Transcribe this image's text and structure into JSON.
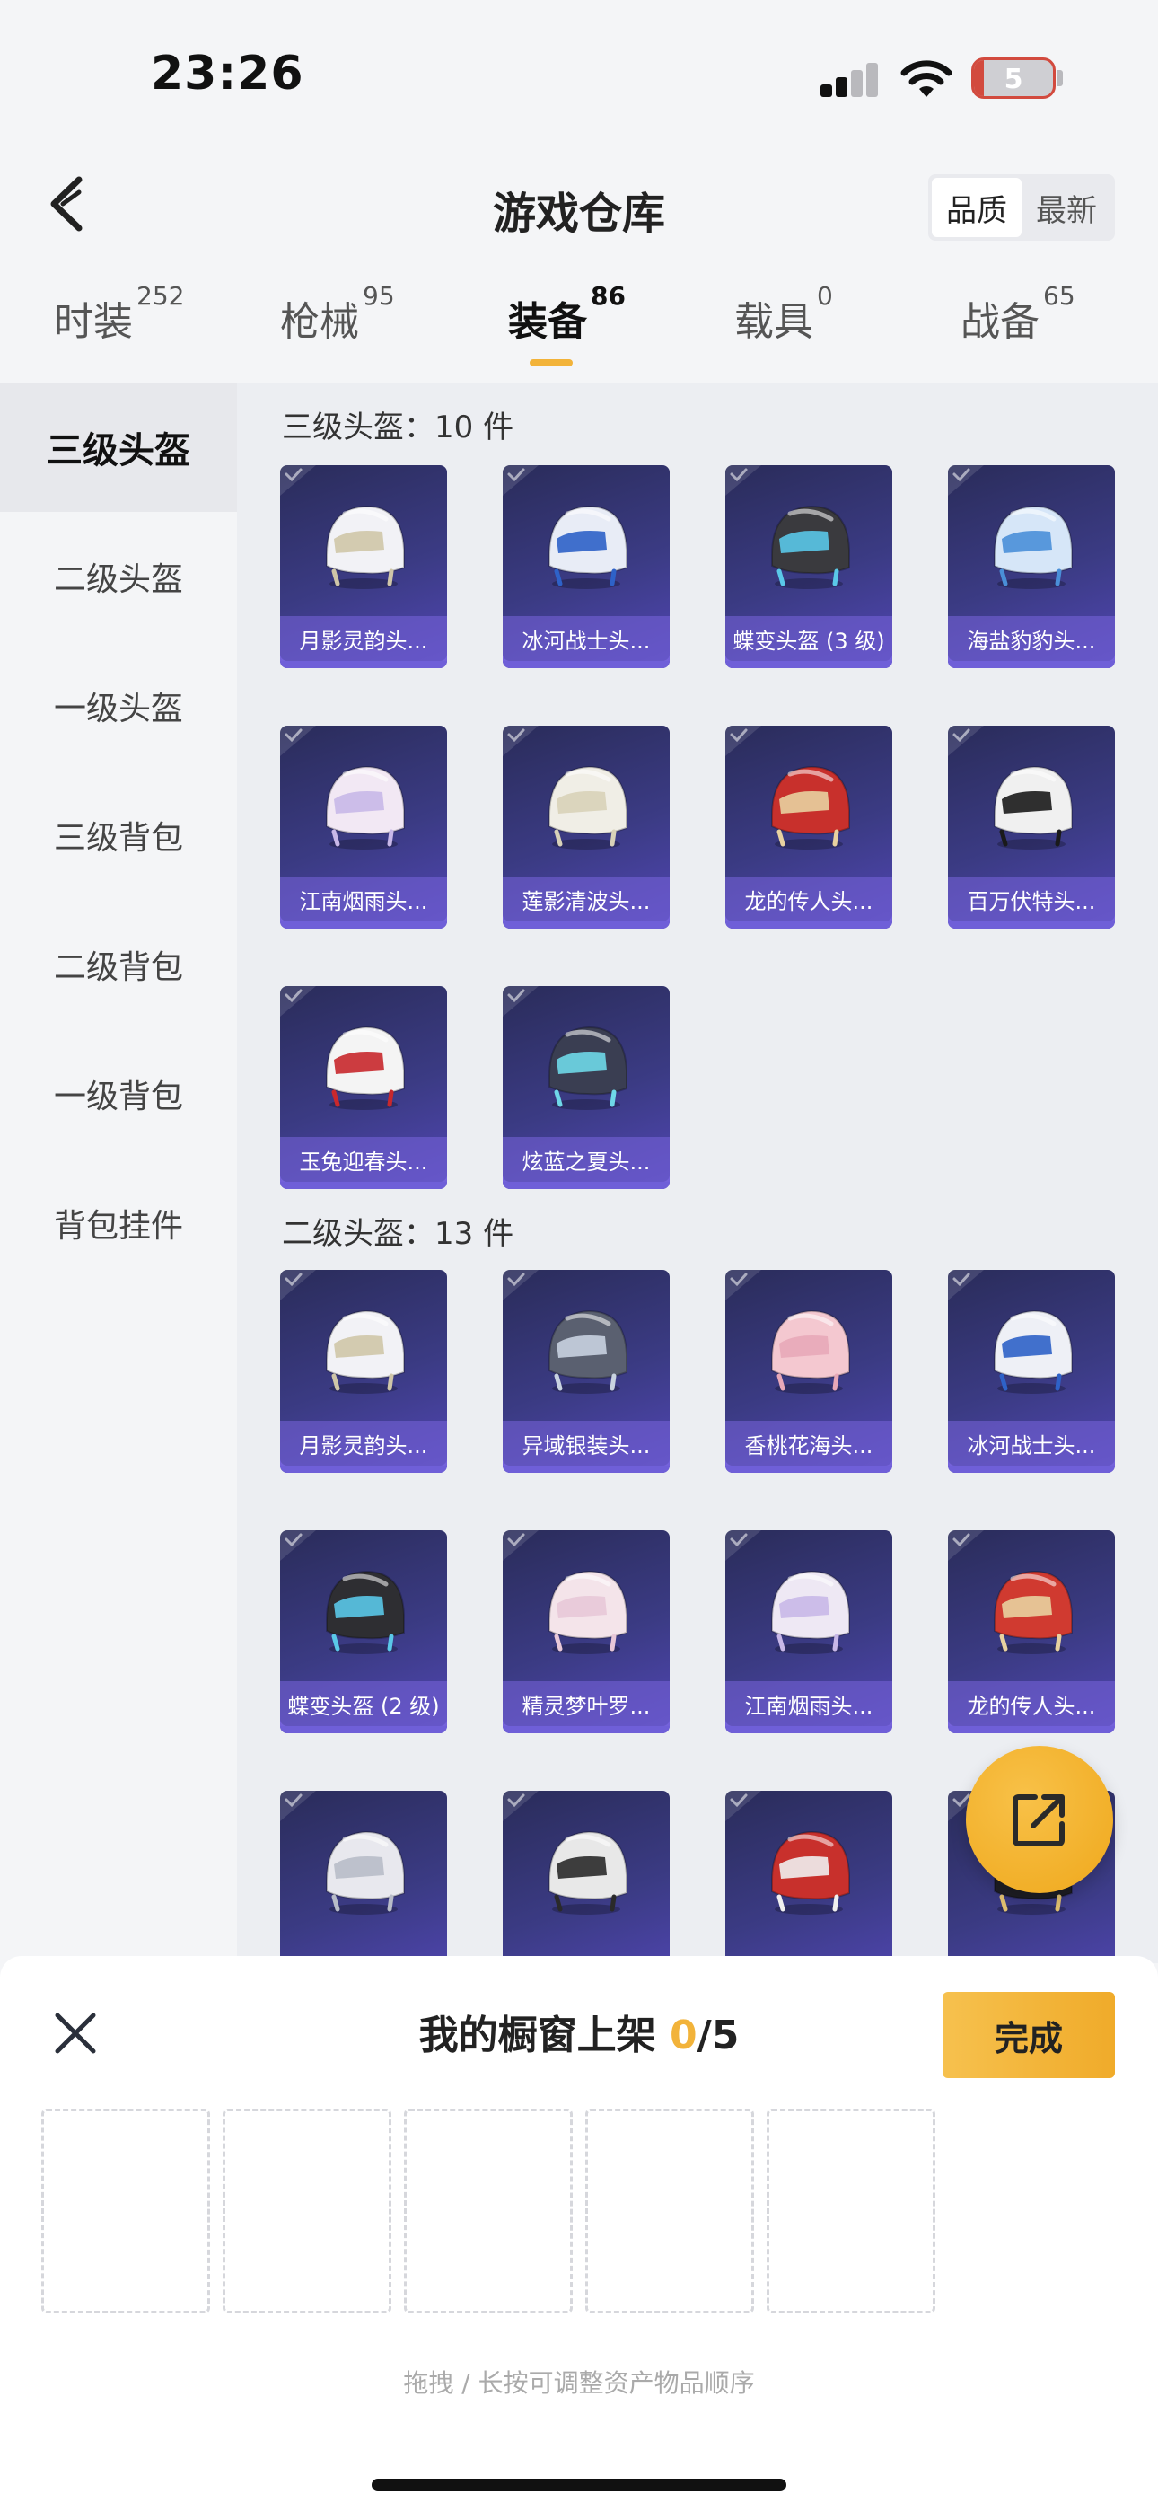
{
  "status_bar": {
    "time": "23:26",
    "battery": "5"
  },
  "header": {
    "title": "游戏仓库",
    "sort_options": [
      "品质",
      "最新"
    ]
  },
  "tabs": [
    {
      "label": "时装",
      "count": "252"
    },
    {
      "label": "枪械",
      "count": "95"
    },
    {
      "label": "装备",
      "count": "86"
    },
    {
      "label": "载具",
      "count": "0"
    },
    {
      "label": "战备",
      "count": "65"
    }
  ],
  "sidebar": {
    "items": [
      "三级头盔",
      "二级头盔",
      "一级头盔",
      "三级背包",
      "二级背包",
      "一级背包",
      "背包挂件"
    ]
  },
  "sections": [
    {
      "title": "三级头盔：10 件",
      "items": [
        {
          "name": "月影灵韵头...",
          "colors": [
            "#f2f2f6",
            "#cfc6a8"
          ]
        },
        {
          "name": "冰河战士头...",
          "colors": [
            "#e8ecf6",
            "#2e62c8"
          ]
        },
        {
          "name": "蝶变头盔 (3 级)",
          "colors": [
            "#3a3a3e",
            "#5ac8e8"
          ]
        },
        {
          "name": "海盐豹豹头...",
          "colors": [
            "#d6e6f8",
            "#4a8fd8"
          ]
        },
        {
          "name": "江南烟雨头...",
          "colors": [
            "#f2e8f4",
            "#c8b8e8"
          ]
        },
        {
          "name": "莲影清波头...",
          "colors": [
            "#f0eee6",
            "#d8d2b8"
          ]
        },
        {
          "name": "龙的传人头...",
          "colors": [
            "#c8302c",
            "#e8d2a0"
          ]
        },
        {
          "name": "百万伏特头...",
          "colors": [
            "#f0f0f0",
            "#1a1a1a"
          ]
        },
        {
          "name": "玉兔迎春头...",
          "colors": [
            "#f4f4f4",
            "#c8282c"
          ]
        },
        {
          "name": "炫蓝之夏头...",
          "colors": [
            "#3a3e52",
            "#6fd8e8"
          ]
        }
      ]
    },
    {
      "title": "二级头盔：13 件",
      "items": [
        {
          "name": "月影灵韵头...",
          "colors": [
            "#f2f2f6",
            "#cfc6a8"
          ]
        },
        {
          "name": "异域银装头...",
          "colors": [
            "#5a6070",
            "#c8d2e0"
          ]
        },
        {
          "name": "香桃花海头...",
          "colors": [
            "#f4c8d0",
            "#e8a8b8"
          ]
        },
        {
          "name": "冰河战士头...",
          "colors": [
            "#eef0f6",
            "#2e62c8"
          ]
        },
        {
          "name": "蝶变头盔 (2 级)",
          "colors": [
            "#2e2e32",
            "#5ac8e8"
          ]
        },
        {
          "name": "精灵梦叶罗...",
          "colors": [
            "#f4e4ea",
            "#e8c8d8"
          ]
        },
        {
          "name": "江南烟雨头...",
          "colors": [
            "#eee8f4",
            "#c8b8e8"
          ]
        },
        {
          "name": "龙的传人头...",
          "colors": [
            "#d03a30",
            "#e8d2a0"
          ]
        },
        {
          "name": "",
          "colors": [
            "#e8e8ee",
            "#b8bcc8"
          ]
        },
        {
          "name": "",
          "colors": [
            "#e8e8e8",
            "#2a2a2a"
          ]
        },
        {
          "name": "",
          "colors": [
            "#c8302c",
            "#f0f0f0"
          ]
        },
        {
          "name": "",
          "colors": [
            "#1e1e24",
            "#e0c070"
          ]
        }
      ]
    }
  ],
  "showcase": {
    "title_prefix": "我的橱窗上架 ",
    "count": "0",
    "total": "/5",
    "done_label": "完成",
    "hint": "拖拽 / 长按可调整资产物品顺序"
  }
}
